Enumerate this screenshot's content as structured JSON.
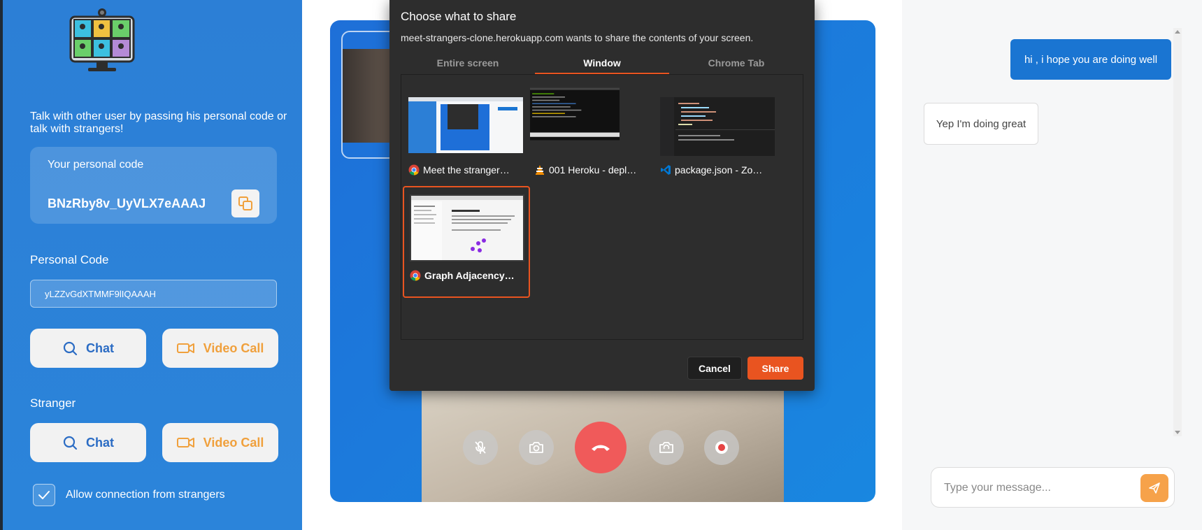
{
  "sidebar": {
    "intro_text": "Talk with other user by passing his personal code or talk with strangers!",
    "personal_code_card": {
      "label": "Your personal code",
      "value": "BNzRby8v_UyVLX7eAAAJ"
    },
    "personal_code_section": {
      "label": "Personal Code",
      "input_value": "yLZZvGdXTMMF9lIQAAAH"
    },
    "personal_buttons": {
      "chat": "Chat",
      "video_call": "Video Call"
    },
    "stranger_section": {
      "label": "Stranger"
    },
    "stranger_buttons": {
      "chat": "Chat",
      "video_call": "Video Call"
    },
    "allow_strangers": {
      "label": "Allow connection from strangers",
      "checked": true
    }
  },
  "video_controls": [
    "mic-off-icon",
    "camera-icon",
    "hang-up-icon",
    "screen-share-icon",
    "record-icon"
  ],
  "chat": {
    "messages": [
      {
        "side": "right",
        "text": "hi , i hope you are doing well"
      },
      {
        "side": "left",
        "text": "Yep I'm doing great"
      }
    ],
    "input_placeholder": "Type your message..."
  },
  "share_dialog": {
    "title": "Choose what to share",
    "subtitle": "meet-strangers-clone.herokuapp.com wants to share the contents of your screen.",
    "tabs": [
      "Entire screen",
      "Window",
      "Chrome Tab"
    ],
    "active_tab": "Window",
    "windows": [
      {
        "label": "Meet the stranger…",
        "icon": "chrome-icon",
        "selected": false
      },
      {
        "label": "001 Heroku - depl…",
        "icon": "vlc-icon",
        "selected": false
      },
      {
        "label": "package.json - Zo…",
        "icon": "vscode-icon",
        "selected": false
      },
      {
        "label": "Graph Adjacency…",
        "icon": "chrome-icon",
        "selected": true
      }
    ],
    "cancel_label": "Cancel",
    "share_label": "Share"
  },
  "colors": {
    "sidebar_blue": "#2c7fd6",
    "accent_orange": "#e95420",
    "chat_blue": "#1a75d2",
    "video_orange": "#f0a03c"
  }
}
